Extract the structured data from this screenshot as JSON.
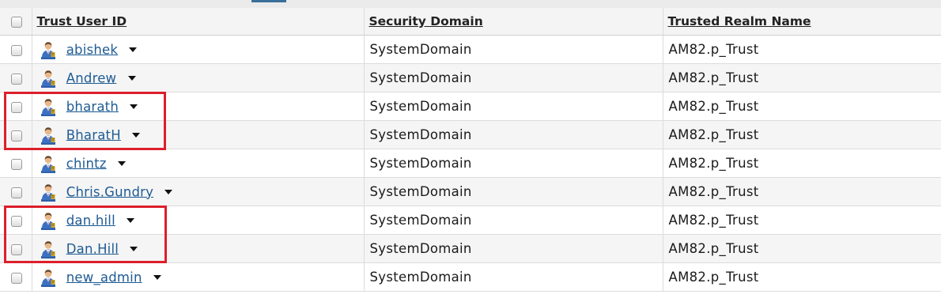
{
  "columns": {
    "trust_user_id": "Trust User ID",
    "security_domain": "Security Domain",
    "trusted_realm_name": "Trusted Realm Name"
  },
  "rows": [
    {
      "user": "abishek",
      "domain": "SystemDomain",
      "realm": "AM82.p_Trust"
    },
    {
      "user": "Andrew",
      "domain": "SystemDomain",
      "realm": "AM82.p_Trust"
    },
    {
      "user": "bharath",
      "domain": "SystemDomain",
      "realm": "AM82.p_Trust"
    },
    {
      "user": "BharatH",
      "domain": "SystemDomain",
      "realm": "AM82.p_Trust"
    },
    {
      "user": "chintz",
      "domain": "SystemDomain",
      "realm": "AM82.p_Trust"
    },
    {
      "user": "Chris.Gundry",
      "domain": "SystemDomain",
      "realm": "AM82.p_Trust"
    },
    {
      "user": "dan.hill",
      "domain": "SystemDomain",
      "realm": "AM82.p_Trust"
    },
    {
      "user": "Dan.Hill",
      "domain": "SystemDomain",
      "realm": "AM82.p_Trust"
    },
    {
      "user": "new_admin",
      "domain": "SystemDomain",
      "realm": "AM82.p_Trust"
    }
  ],
  "icons": {
    "user_row": "user-icon",
    "row_menu": "dropdown-caret-icon",
    "select": "checkbox"
  },
  "colors": {
    "link": "#1f5c94",
    "highlight": "#dd1f2b",
    "alt_row": "#f5f5f5"
  }
}
